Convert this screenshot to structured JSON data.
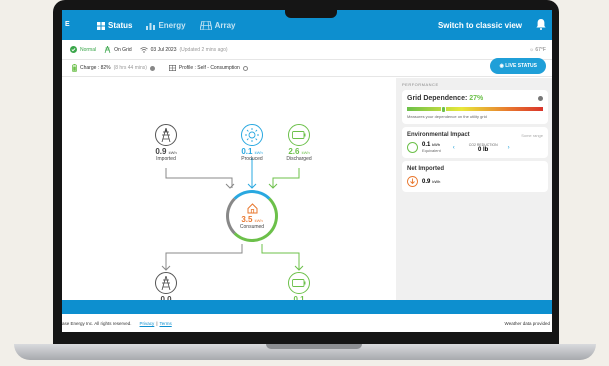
{
  "nav": {
    "logo": "E",
    "status": "Status",
    "energy": "Energy",
    "array": "Array",
    "switch": "Switch to classic view"
  },
  "status": {
    "normal": "Normal",
    "grid": "On Grid",
    "date": "03 Jul 2023",
    "updated": "(Updated 2 mins ago)",
    "weather": "67°F"
  },
  "charge": {
    "label": "Charge : 82%",
    "time": "(8 hrs 44 mins)",
    "profile": "Profile : Self - Consumption",
    "live": "LIVE STATUS"
  },
  "flow": {
    "imported": {
      "value": "0.9",
      "unit": "kWh",
      "label": "Imported"
    },
    "produced": {
      "value": "0.1",
      "unit": "kWh",
      "label": "Produced"
    },
    "discharged": {
      "value": "2.6",
      "unit": "kWh",
      "label": "Discharged"
    },
    "consumed": {
      "value": "3.5",
      "unit": "kWh",
      "label": "Consumed"
    },
    "bottom_left": {
      "value": "0.0"
    },
    "bottom_right": {
      "value": "0.1"
    }
  },
  "performance": {
    "header": "PERFORMANCE",
    "grid_title": "Grid Dependence:",
    "grid_value": "27%",
    "grid_fraction": 0.27,
    "grid_desc": "Measures your dependence on the utility grid",
    "env_title": "Environmental Impact",
    "env_link": "Some range",
    "env_value": "0.1",
    "env_unit": "kWh",
    "env_sub": "Equivalent",
    "co2_label": "CO2 REDUCTION",
    "co2_value": "0 lb",
    "net_title": "Net Imported",
    "net_value": "0.9",
    "net_unit": "kWh"
  },
  "footer": {
    "copy": "ase Energy Inc. All rights reserved.",
    "privacy": "Privacy",
    "terms": "Terms",
    "weather": "Weather data provided"
  },
  "colors": {
    "accent": "#0d8fcf",
    "green": "#6cc04a",
    "orange": "#e8772e",
    "solar": "#29a8e0"
  }
}
